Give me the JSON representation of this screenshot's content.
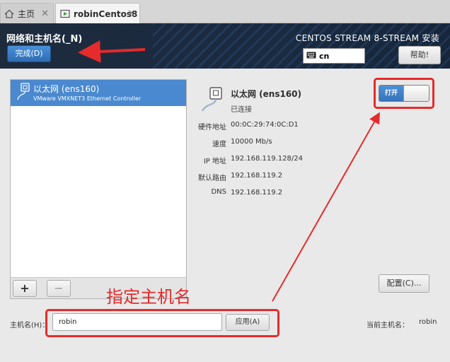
{
  "tabs": [
    {
      "label": "主页",
      "close": "✕"
    },
    {
      "label": "robinCentos8",
      "close": "✕"
    }
  ],
  "header": {
    "title": "网络和主机名(_N)",
    "done_label": "完成(D)",
    "install_title": "CENTOS STREAM 8-STREAM 安装",
    "keyboard_layout": "cn",
    "help_label": "帮助!"
  },
  "device_list": {
    "items": [
      {
        "name": "以太网 (ens160)",
        "description": "VMware VMXNET3 Ethernet Controller"
      }
    ],
    "add_label": "+",
    "remove_label": "−"
  },
  "details": {
    "name": "以太网 (ens160)",
    "status": "已连接",
    "switch_label": "打开",
    "rows": [
      {
        "label": "硬件地址",
        "value": "00:0C:29:74:0C:D1"
      },
      {
        "label": "速度",
        "value": "10000 Mb/s"
      },
      {
        "label": "IP 地址",
        "value": "192.168.119.128/24"
      },
      {
        "label": "默认路由",
        "value": "192.168.119.2"
      },
      {
        "label": "DNS",
        "value": "192.168.119.2"
      }
    ],
    "configure_label": "配置(C)..."
  },
  "hostname": {
    "label": "主机名(H)：",
    "value": "robin",
    "apply_label": "应用(A)",
    "current_label": "当前主机名：",
    "current_value": "robin"
  },
  "annotation": {
    "text": "指定主机名",
    "color": "#e52b2b"
  },
  "colors": {
    "accent": "#4a89cf",
    "header_bg": "#1d2b3d"
  }
}
